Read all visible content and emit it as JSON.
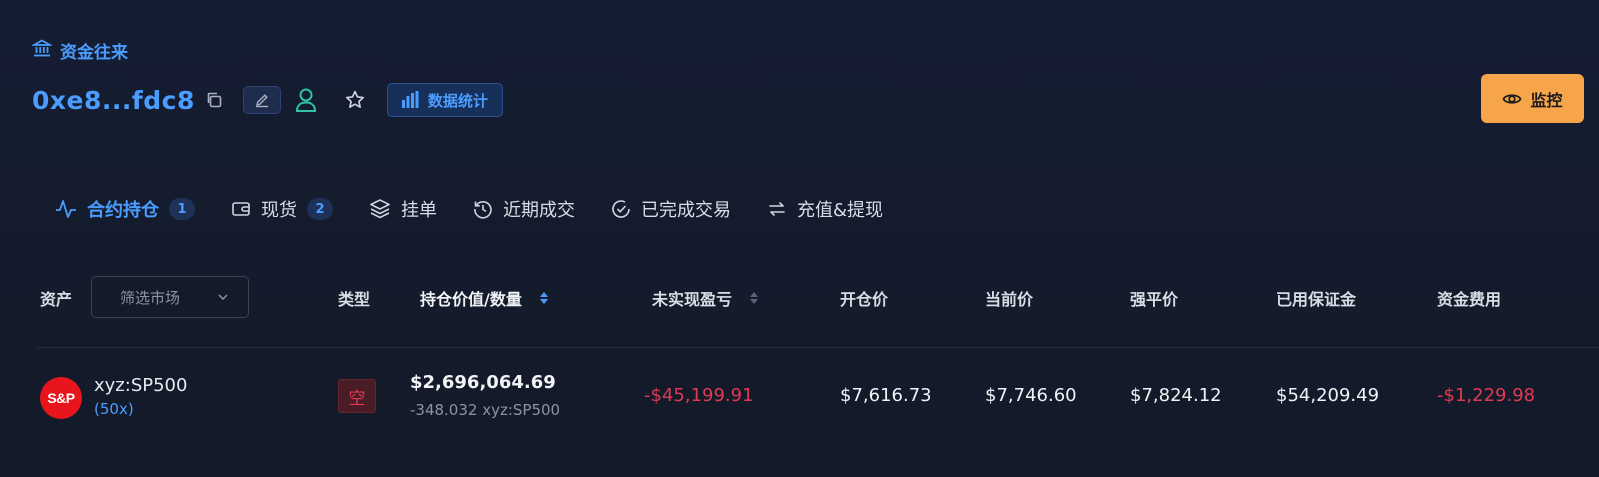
{
  "header": {
    "breadcrumb": "资金往来",
    "address": "0xe8...fdc8",
    "stats_label": "数据统计"
  },
  "monitor_label": "监控",
  "tabs": [
    {
      "label": "合约持仓",
      "badge": "1",
      "active": true,
      "icon": "pulse-icon"
    },
    {
      "label": "现货",
      "badge": "2",
      "active": false,
      "icon": "wallet-icon"
    },
    {
      "label": "挂单",
      "active": false,
      "icon": "layers-icon"
    },
    {
      "label": "近期成交",
      "active": false,
      "icon": "history-icon"
    },
    {
      "label": "已完成交易",
      "active": false,
      "icon": "check-circle-icon"
    },
    {
      "label": "充值&提现",
      "active": false,
      "icon": "transfer-icon"
    }
  ],
  "table": {
    "columns": {
      "asset": "资产",
      "filter_placeholder": "筛选市场",
      "type": "类型",
      "position": "持仓价值/数量",
      "pnl": "未实现盈亏",
      "entry": "开仓价",
      "mark": "当前价",
      "liq": "强平价",
      "margin": "已用保证金",
      "funding": "资金费用"
    },
    "rows": [
      {
        "logo_text": "S&P",
        "asset": "xyz:SP500",
        "leverage": "(50x)",
        "type": "空",
        "position_value": "$2,696,064.69",
        "position_qty": "-348.032 xyz:SP500",
        "pnl": "-$45,199.91",
        "entry": "$7,616.73",
        "mark": "$7,746.60",
        "liq": "$7,824.12",
        "margin": "$54,209.49",
        "funding": "-$1,229.98"
      }
    ]
  },
  "colors": {
    "accent": "#4a9dff",
    "negative": "#e03a52",
    "monitor": "#f7a54a",
    "positive_icon": "#2ec4a0"
  }
}
